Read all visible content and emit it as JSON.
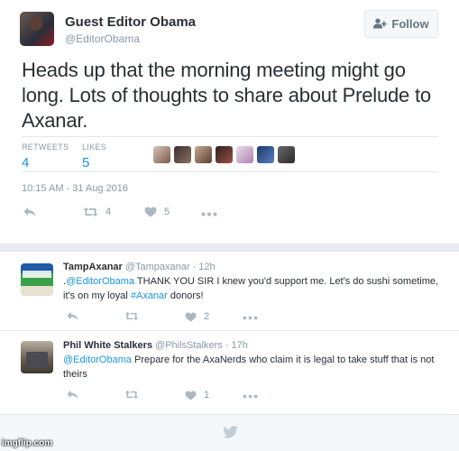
{
  "main_tweet": {
    "name": "Guest Editor Obama",
    "handle": "@EditorObama",
    "follow_label": "Follow",
    "follow_icon": "👤+",
    "text": "Heads up that the morning meeting might go long. Lots of thoughts to share about Prelude to Axanar.",
    "retweets_label": "RETWEETS",
    "retweets_value": "4",
    "likes_label": "LIKES",
    "likes_value": "5",
    "timestamp": "10:15 AM - 31 Aug 2016",
    "actions": {
      "retweet_count": "4",
      "like_count": "5"
    }
  },
  "replies": [
    {
      "name": "TampAxanar",
      "meta": "@Tampaxanar · 12h",
      "text_prefix": ".",
      "mention": "@EditorObama",
      "text_main": " THANK YOU SIR I knew you'd support me.  Let's do sushi sometime, it's on my loyal ",
      "hashtag": "#Axanar",
      "text_suffix": " donors!",
      "like_count": "2"
    },
    {
      "name": "Phil White Stalkers",
      "meta": "@PhilsStalkers · 17h",
      "mention": "@EditorObama",
      "text_main": " Prepare for the AxaNerds who claim it is legal to take stuff that is not theirs",
      "like_count": "1"
    }
  ],
  "watermark": "imgflip.com",
  "colors": {
    "accent": "#1b95e0",
    "muted": "#8899a6",
    "text": "#292f33",
    "border": "#e1e8ed"
  }
}
